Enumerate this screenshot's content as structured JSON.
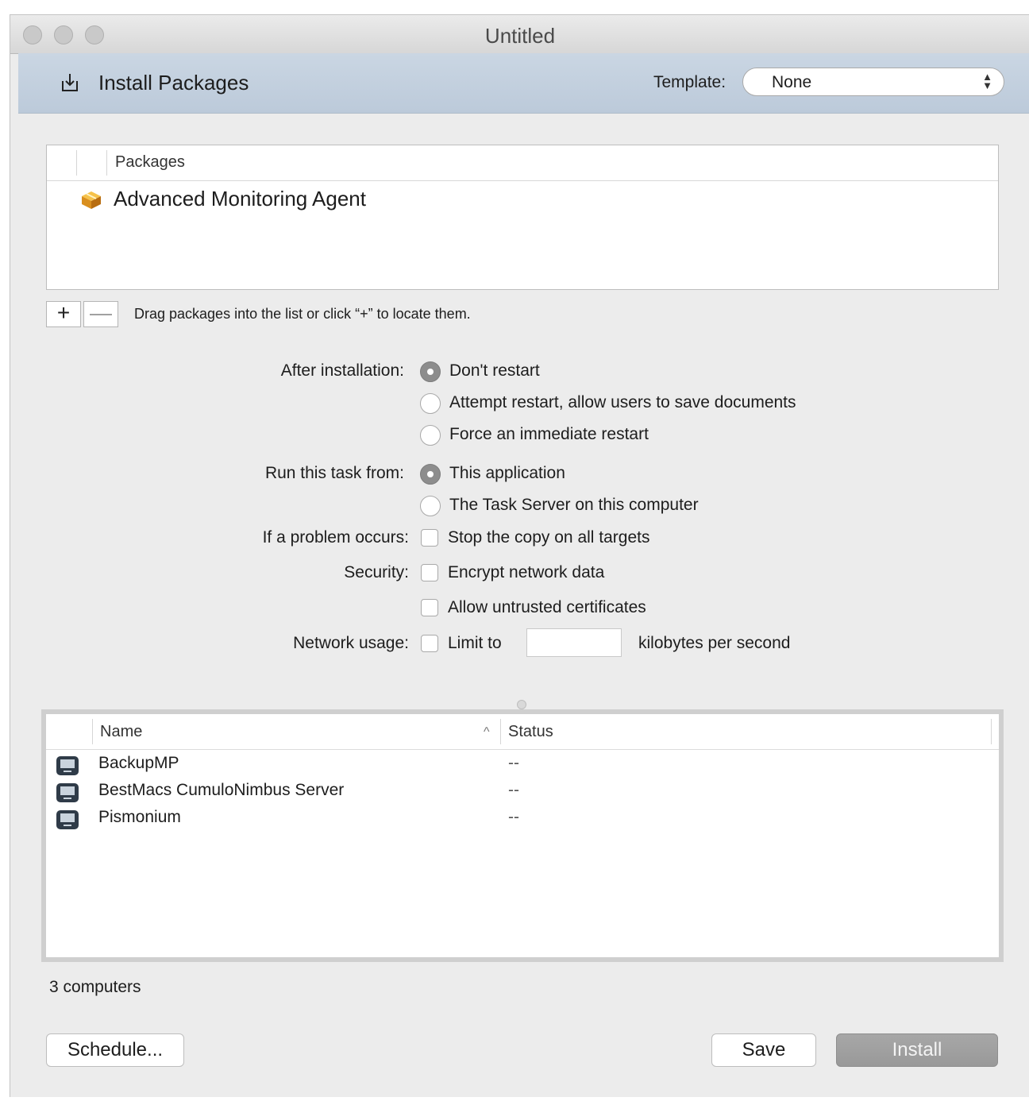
{
  "window": {
    "title": "Untitled"
  },
  "header": {
    "title": "Install Packages",
    "icon": "install-icon",
    "template_label": "Template:",
    "template_value": "None"
  },
  "packages": {
    "column_header": "Packages",
    "items": [
      {
        "name": "Advanced Monitoring Agent",
        "icon": "package-icon"
      }
    ],
    "add_label": "+",
    "remove_label": "—",
    "hint": "Drag packages into the list or click “+” to locate them."
  },
  "options": {
    "after_installation": {
      "label": "After installation:",
      "choices": [
        "Don't restart",
        "Attempt restart, allow users to save documents",
        "Force an immediate restart"
      ],
      "selected": 0
    },
    "run_from": {
      "label": "Run this task from:",
      "choices": [
        "This application",
        "The Task Server on this computer"
      ],
      "selected": 0
    },
    "problem": {
      "label": "If a problem occurs:",
      "checkbox": "Stop the copy on all targets",
      "checked": false
    },
    "security": {
      "label": "Security:",
      "checkboxes": [
        {
          "text": "Encrypt network data",
          "checked": false
        },
        {
          "text": "Allow untrusted certificates",
          "checked": false
        }
      ]
    },
    "network": {
      "label": "Network usage:",
      "checkbox": "Limit to",
      "checked": false,
      "value": "",
      "unit": "kilobytes per second"
    }
  },
  "computers": {
    "columns": {
      "name": "Name",
      "status": "Status"
    },
    "sort_indicator": "^",
    "rows": [
      {
        "name": "BackupMP",
        "status": "--"
      },
      {
        "name": "BestMacs CumuloNimbus Server",
        "status": "--"
      },
      {
        "name": "Pismonium",
        "status": "--"
      }
    ],
    "count_label": "3 computers"
  },
  "buttons": {
    "schedule": "Schedule...",
    "save": "Save",
    "install": "Install"
  }
}
